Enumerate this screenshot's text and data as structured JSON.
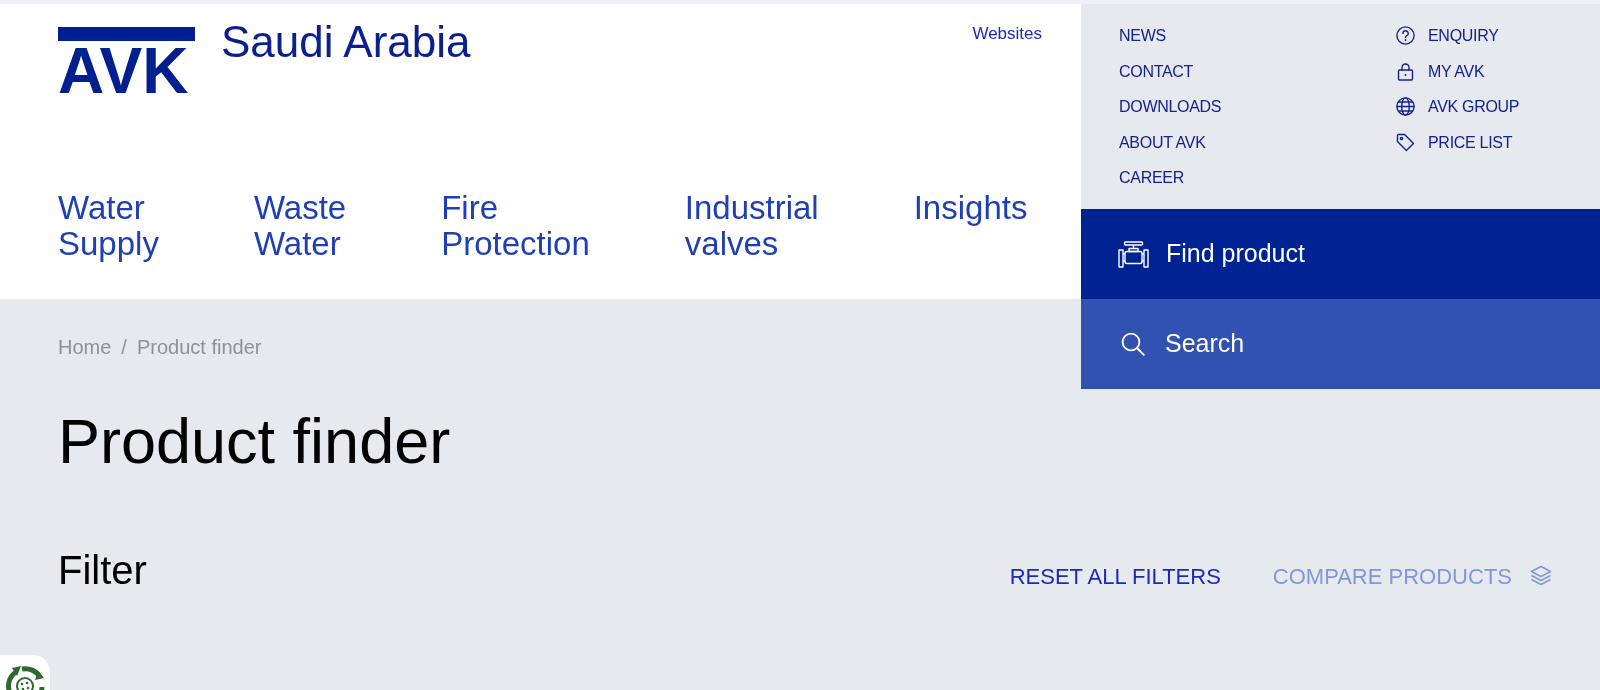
{
  "header": {
    "logo": "AVK",
    "site_title": "Saudi Arabia",
    "websites_link": "Websites",
    "nav": [
      {
        "label": "Water Supply"
      },
      {
        "label": "Waste Water"
      },
      {
        "label": "Fire Protection"
      },
      {
        "label": "Industrial valves"
      },
      {
        "label": "Insights"
      }
    ]
  },
  "utility_menu": {
    "left": [
      {
        "label": "NEWS"
      },
      {
        "label": "CONTACT"
      },
      {
        "label": "DOWNLOADS"
      },
      {
        "label": "ABOUT AVK"
      },
      {
        "label": "CAREER"
      }
    ],
    "right": [
      {
        "label": "ENQUIRY"
      },
      {
        "label": "MY AVK"
      },
      {
        "label": "AVK GROUP"
      },
      {
        "label": "PRICE LIST"
      }
    ]
  },
  "find_product": {
    "label": "Find product"
  },
  "search": {
    "label": "Search"
  },
  "breadcrumb": {
    "items": [
      {
        "label": "Home"
      },
      {
        "label": "Product finder"
      }
    ],
    "separator": "/"
  },
  "page_title": "Product finder",
  "filter": {
    "title": "Filter",
    "reset": "RESET ALL FILTERS",
    "compare": {
      "label": "COMPARE PRODUCTS",
      "disabled": true
    }
  }
}
